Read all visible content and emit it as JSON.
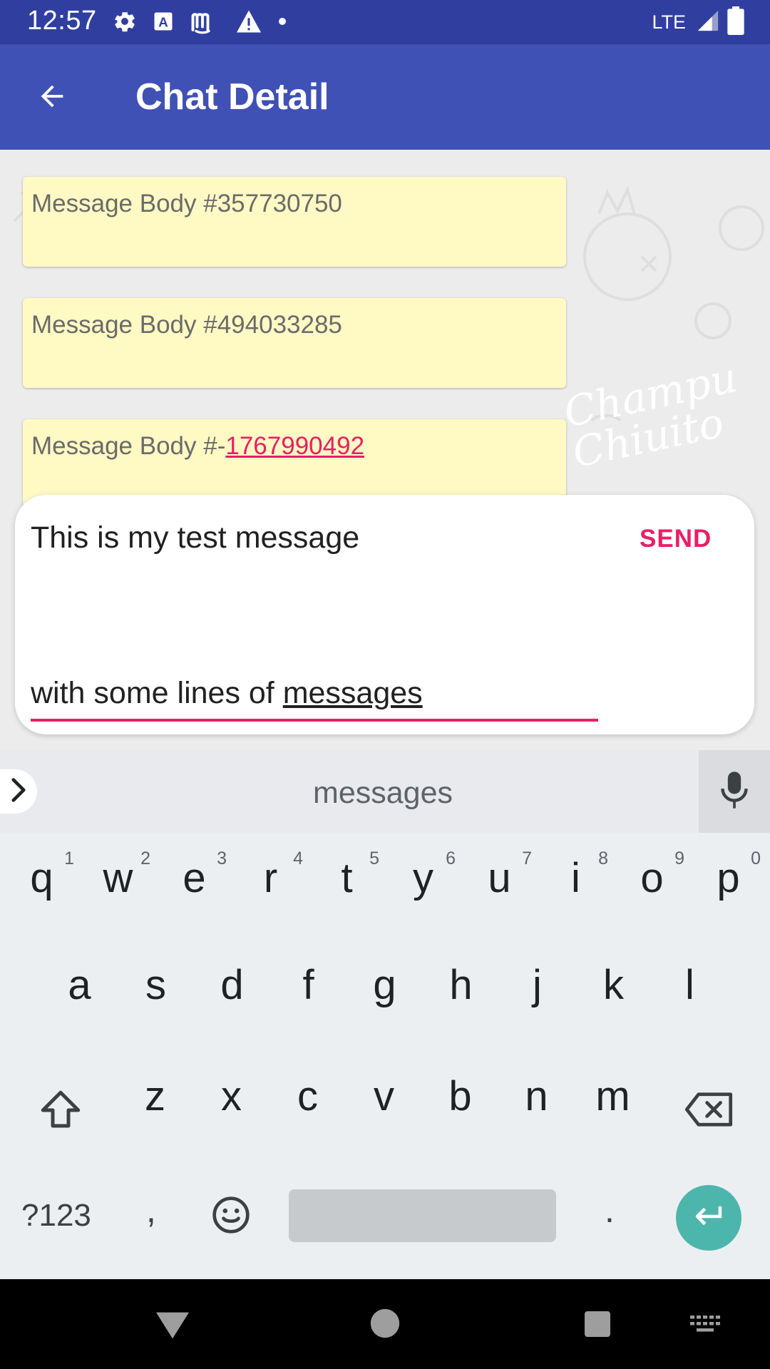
{
  "status_bar": {
    "time": "12:57",
    "network": "LTE",
    "icons_left": [
      "gear-icon",
      "text-a-icon",
      "app-logo-icon",
      "warning-icon",
      "dot-icon"
    ],
    "icons_right": [
      "signal-icon",
      "battery-icon"
    ]
  },
  "app_bar": {
    "title": "Chat Detail",
    "back_icon": "arrow-left-icon",
    "color": "#3f51b5"
  },
  "chat": {
    "watermark": "Champu Chiuito",
    "messages": [
      {
        "text": "Message Body #357730750"
      },
      {
        "text": "Message Body #494033285"
      },
      {
        "text_prefix": "Message Body #-",
        "link": "1767990492"
      }
    ],
    "bubble_color": "#fff9c4"
  },
  "compose": {
    "line1": "This is my test message",
    "line2_prefix": "with some lines of ",
    "line2_word": "messages",
    "send_label": "SEND",
    "accent": "#e91e63"
  },
  "keyboard": {
    "suggestion": "messages",
    "row1": [
      {
        "key": "q",
        "hint": "1"
      },
      {
        "key": "w",
        "hint": "2"
      },
      {
        "key": "e",
        "hint": "3"
      },
      {
        "key": "r",
        "hint": "4"
      },
      {
        "key": "t",
        "hint": "5"
      },
      {
        "key": "y",
        "hint": "6"
      },
      {
        "key": "u",
        "hint": "7"
      },
      {
        "key": "i",
        "hint": "8"
      },
      {
        "key": "o",
        "hint": "9"
      },
      {
        "key": "p",
        "hint": "0"
      }
    ],
    "row2": [
      "a",
      "s",
      "d",
      "f",
      "g",
      "h",
      "j",
      "k",
      "l"
    ],
    "row3": [
      "z",
      "x",
      "c",
      "v",
      "b",
      "n",
      "m"
    ],
    "symbols_label": "?123",
    "comma": ",",
    "period": ".",
    "enter_color": "#4db6ac"
  },
  "nav_bar": {
    "icons": [
      "back-triangle-icon",
      "home-circle-icon",
      "recents-square-icon",
      "keyboard-switch-icon"
    ]
  }
}
